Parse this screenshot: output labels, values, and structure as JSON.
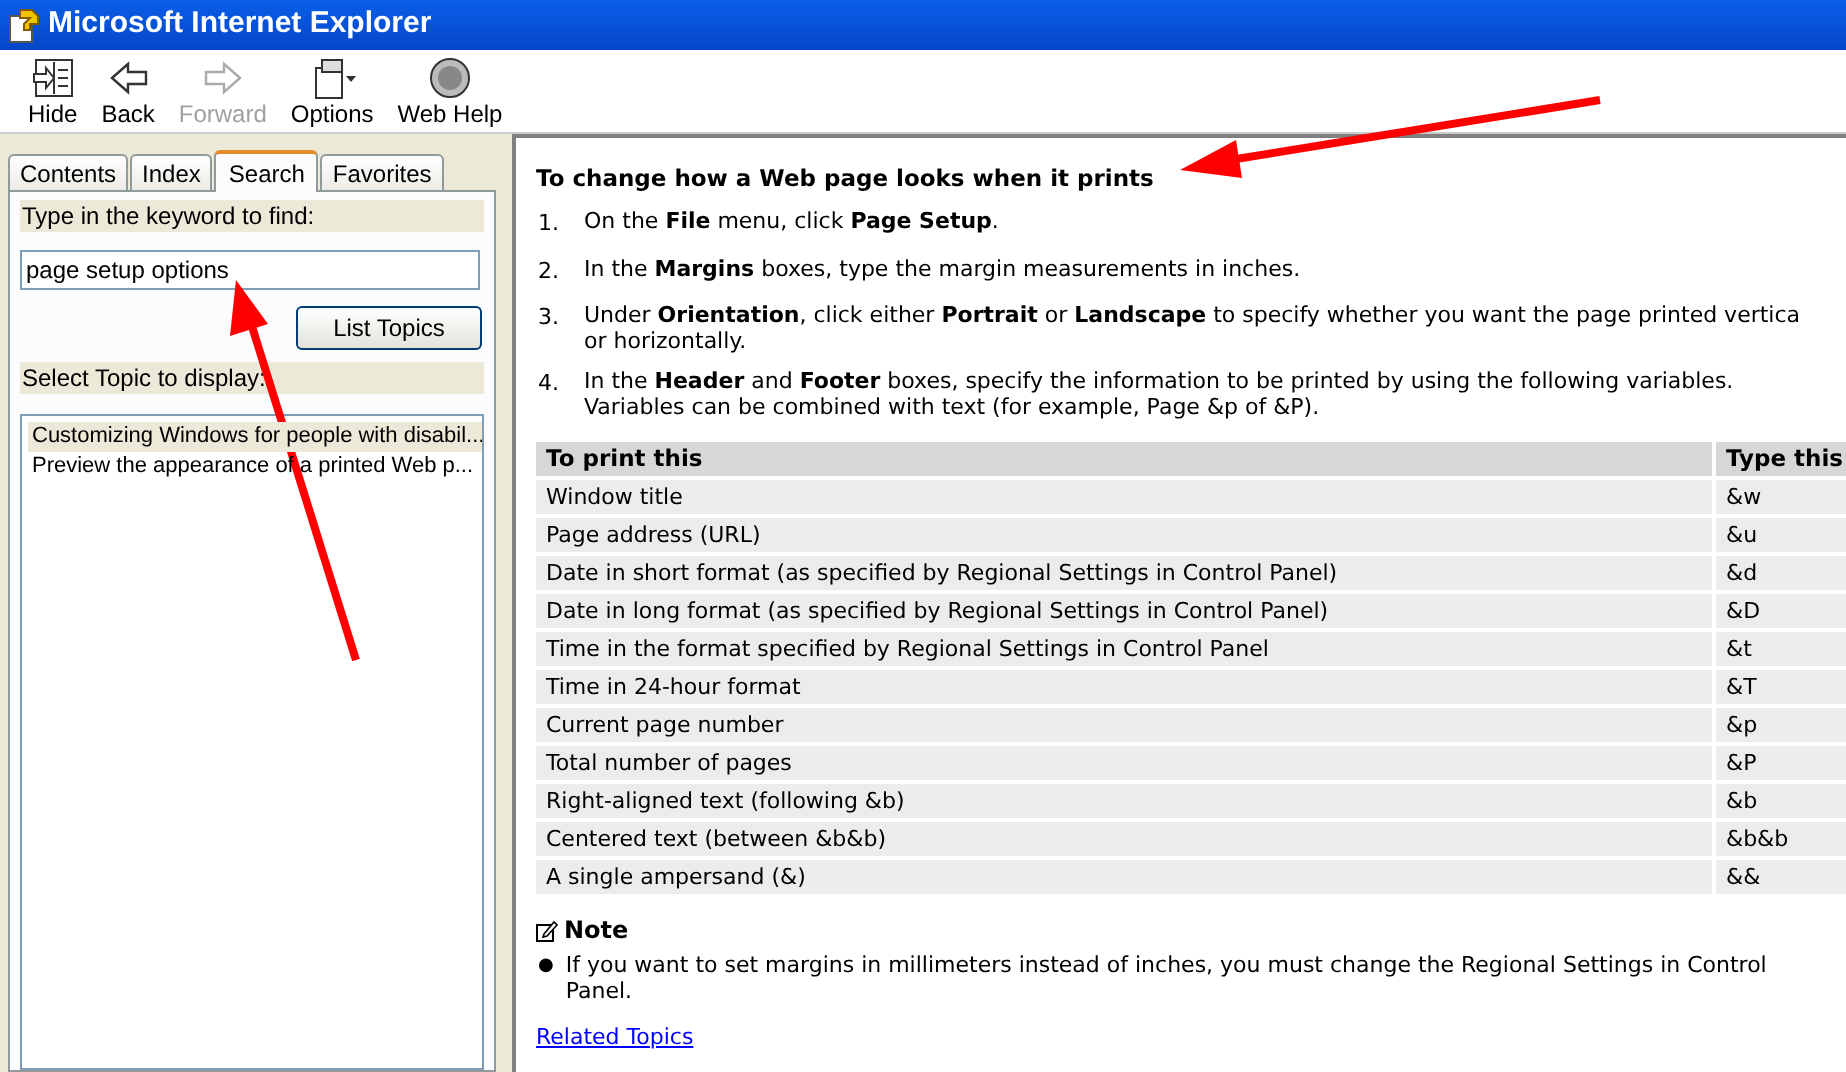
{
  "window": {
    "title": "Microsoft Internet Explorer"
  },
  "toolbar": [
    {
      "kind": "hide",
      "label": "Hide",
      "disabled": false
    },
    {
      "kind": "back",
      "label": "Back",
      "disabled": false
    },
    {
      "kind": "forward",
      "label": "Forward",
      "disabled": true
    },
    {
      "kind": "options",
      "label": "Options",
      "disabled": false
    },
    {
      "kind": "webhelp",
      "label": "Web Help",
      "disabled": false
    }
  ],
  "tabs": [
    {
      "label": "Contents",
      "selected": false
    },
    {
      "label": "Index",
      "selected": false
    },
    {
      "label": "Search",
      "selected": true
    },
    {
      "label": "Favorites",
      "selected": false
    }
  ],
  "search": {
    "keyword_label": "Type in the keyword to find:",
    "value": "page setup options",
    "button": "List Topics",
    "topics_label": "Select Topic to display:",
    "topics": [
      {
        "label": "Customizing Windows for people with disabil...",
        "selected": true
      },
      {
        "label": "Preview the appearance of a printed Web p...",
        "selected": false
      }
    ]
  },
  "article": {
    "title": "To change how a Web page looks when it prints",
    "steps": [
      {
        "number": "1.",
        "lines": [
          "On the **File** menu, click **Page Setup**."
        ]
      },
      {
        "number": "2.",
        "lines": [
          "In the **Margins** boxes, type the margin measurements in inches."
        ]
      },
      {
        "number": "3.",
        "lines": [
          "Under **Orientation**, click either **Portrait** or **Landscape** to specify whether you want the page printed vertica",
          "or horizontally."
        ]
      },
      {
        "number": "4.",
        "lines": [
          "In the **Header** and **Footer** boxes, specify the information to be printed by using the following variables.",
          "Variables can be combined with text (for example, Page &p of &P)."
        ]
      }
    ],
    "table": {
      "columns": [
        "To print this",
        "Type this"
      ],
      "rows": [
        [
          "Window title",
          "&w"
        ],
        [
          "Page address (URL)",
          "&u"
        ],
        [
          "Date in short format (as specified by Regional Settings in Control Panel)",
          "&d"
        ],
        [
          "Date in long format (as specified by Regional Settings in Control Panel)",
          "&D"
        ],
        [
          "Time in the format specified by Regional Settings in Control Panel",
          "&t"
        ],
        [
          "Time in 24-hour format",
          "&T"
        ],
        [
          "Current page number",
          "&p"
        ],
        [
          "Total number of pages",
          "&P"
        ],
        [
          "Right-aligned text (following &b)",
          "&b"
        ],
        [
          "Centered text (between &b&b)",
          "&b&b"
        ],
        [
          "A single ampersand (&)",
          "&&"
        ]
      ]
    },
    "note": {
      "title": "Note",
      "bullet": "●",
      "lines": [
        "If you want to set margins in millimeters instead of inches, you must change the Regional Settings in Control",
        "Panel."
      ]
    },
    "related_link": "Related Topics"
  }
}
